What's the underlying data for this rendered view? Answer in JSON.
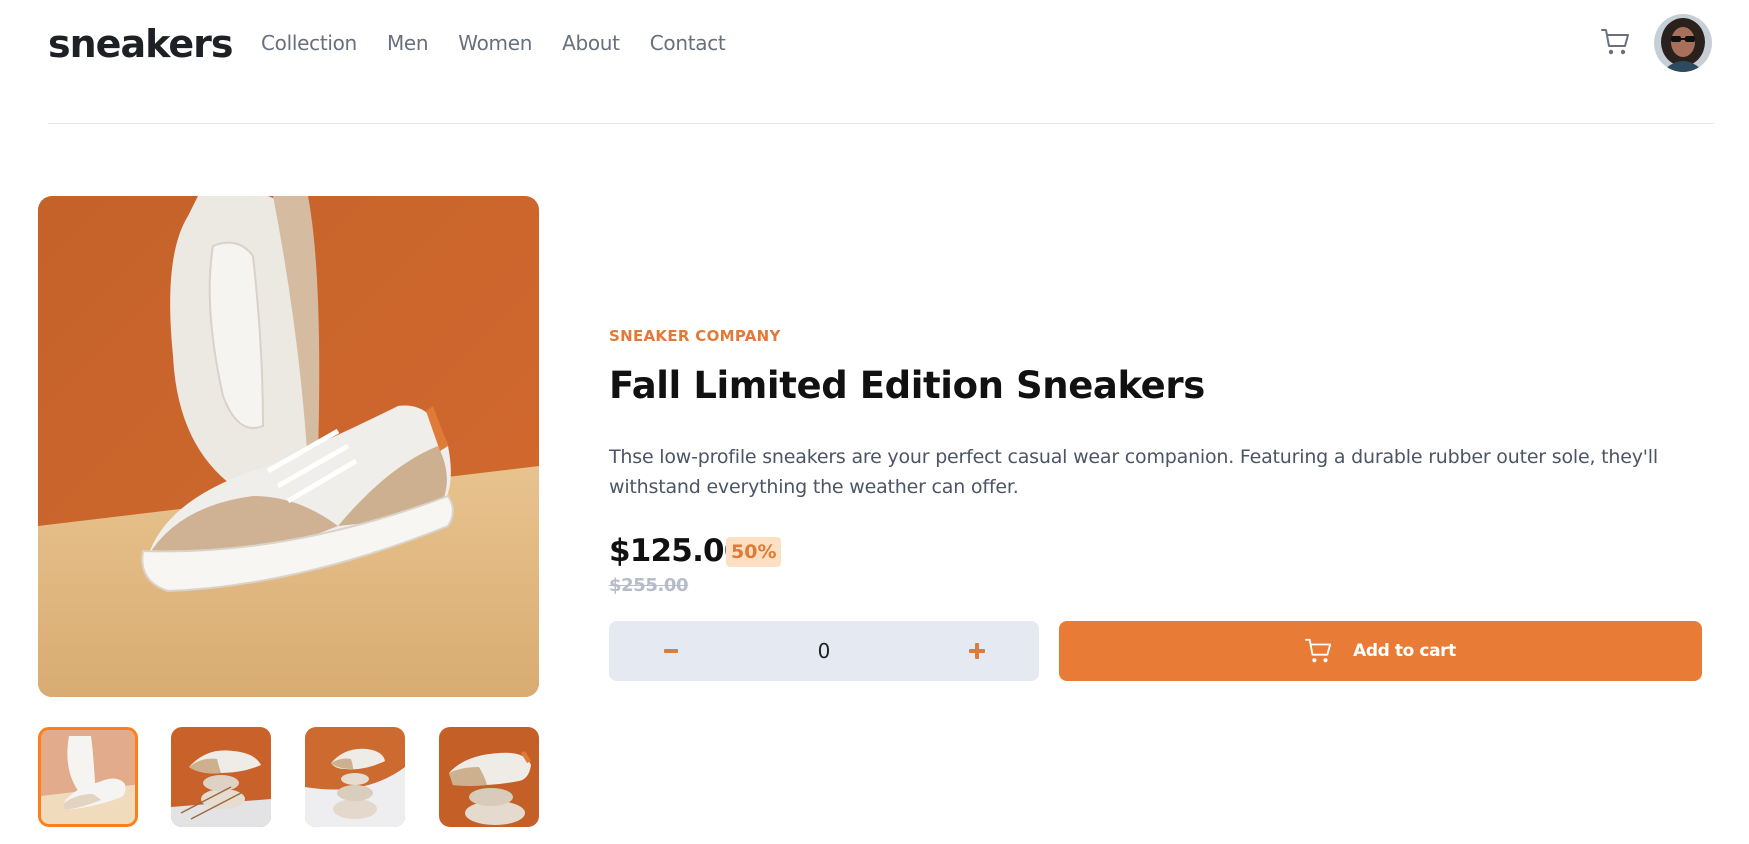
{
  "brand": {
    "logo": "sneakers"
  },
  "nav": {
    "items": [
      "Collection",
      "Men",
      "Women",
      "About",
      "Contact"
    ]
  },
  "header_icons": {
    "cart": "cart-icon",
    "avatar": "user-avatar"
  },
  "gallery": {
    "thumbnails": [
      "thumbnail-1",
      "thumbnail-2",
      "thumbnail-3",
      "thumbnail-4"
    ],
    "active_thumbnail": 0
  },
  "product": {
    "company": "SNEAKER COMPANY",
    "title": "Fall Limited Edition Sneakers",
    "description": "Thse low-profile sneakers are your perfect casual wear companion. Featuring a durable rubber outer sole, they'll withstand everything the weather can offer.",
    "price": "$125.00",
    "discount": "50%",
    "original_price": "$255.00"
  },
  "cart_controls": {
    "quantity": "0",
    "add_label": "Add to cart"
  },
  "colors": {
    "accent": "#e87b35",
    "accent_pale": "#fde0c4",
    "text_dark": "#1d2025",
    "text_muted": "#69707d",
    "control_bg": "#e4e9f2"
  }
}
